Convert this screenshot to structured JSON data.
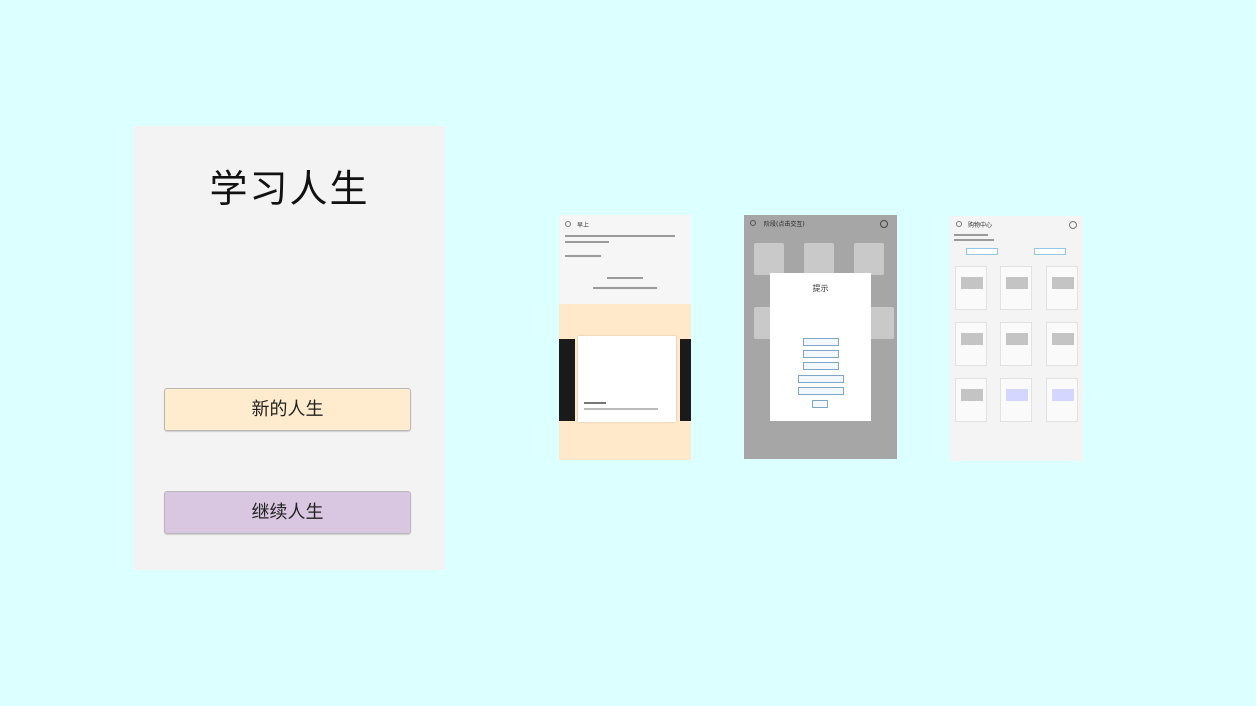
{
  "app": {
    "title": "学习人生",
    "new_life_label": "新的人生",
    "continue_life_label": "继续人生"
  },
  "colors": {
    "background": "#dcffff",
    "screen": "#f3f3f3",
    "new_life_button": "#ffebce",
    "continue_life_button": "#d9c6e0"
  },
  "thumbnails": {
    "game": {
      "header_title": "早上"
    },
    "characters": {
      "header_title": "阶段(点击交互)",
      "modal_title": "提示"
    },
    "shop": {
      "header_title": "购物中心"
    }
  }
}
